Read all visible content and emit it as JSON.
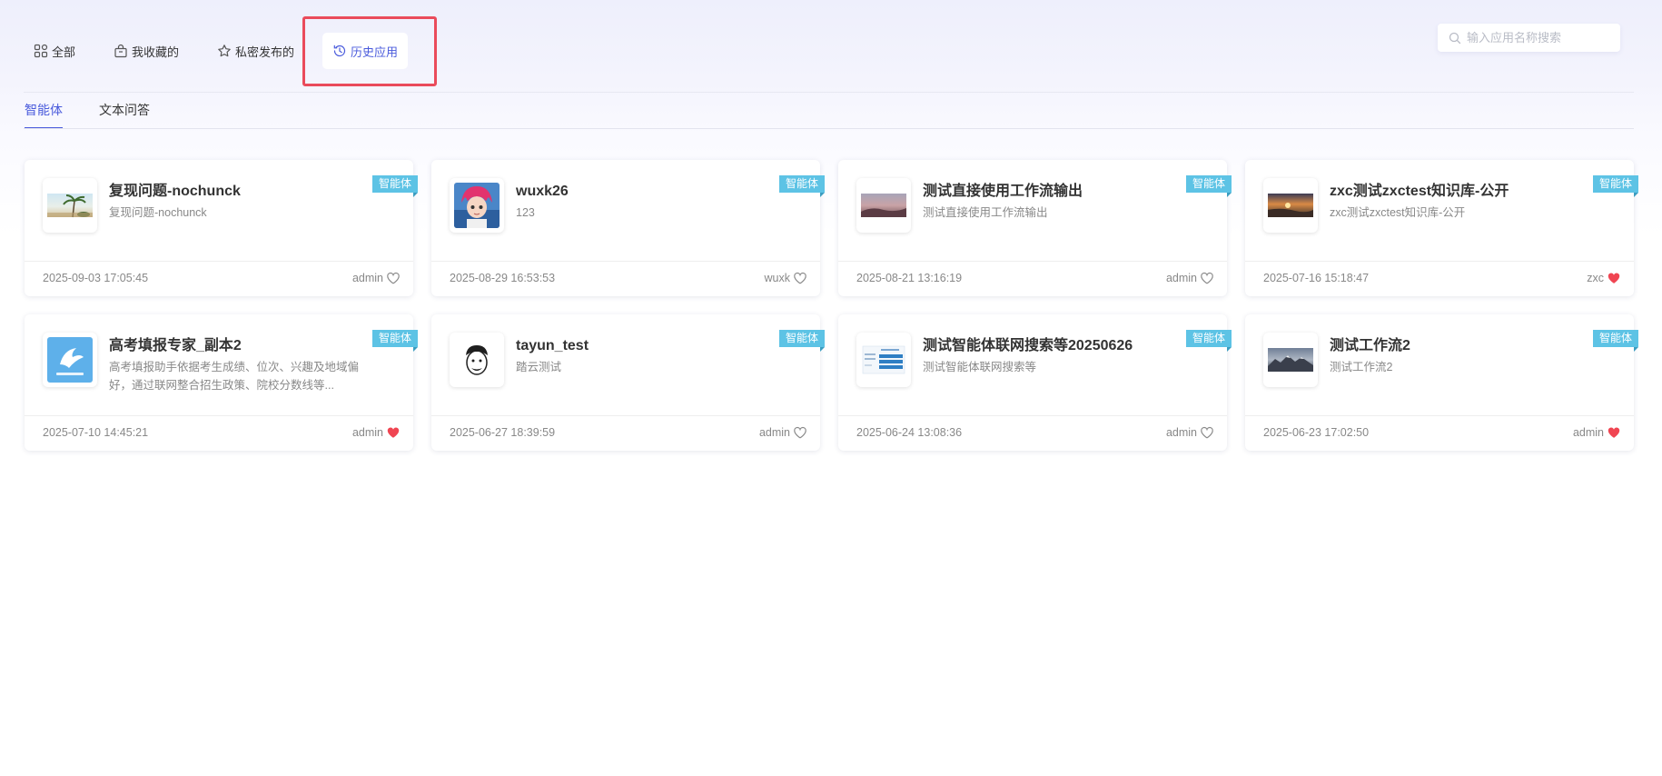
{
  "filters": [
    {
      "label": "全部",
      "icon": "grid-icon"
    },
    {
      "label": "我收藏的",
      "icon": "bag-icon"
    },
    {
      "label": "私密发布的",
      "icon": "star-icon"
    },
    {
      "label": "历史应用",
      "icon": "history-icon",
      "active": true
    }
  ],
  "search": {
    "placeholder": "输入应用名称搜索",
    "value": ""
  },
  "tabs": [
    {
      "label": "智能体",
      "active": true
    },
    {
      "label": "文本问答",
      "active": false
    }
  ],
  "colors": {
    "accent": "#4a5bdc",
    "badge": "#5dc3e5",
    "favorite": "#f04552",
    "highlight": "#ea4b5b"
  },
  "cards": [
    {
      "title": "复现问题-nochunck",
      "desc": "复现问题-nochunck",
      "badge": "智能体",
      "time": "2025-09-03 17:05:45",
      "owner": "admin",
      "favorited": false,
      "thumb": "beach-photo"
    },
    {
      "title": "wuxk26",
      "desc": "123",
      "badge": "智能体",
      "time": "2025-08-29 16:53:53",
      "owner": "wuxk",
      "favorited": false,
      "thumb": "anime-avatar"
    },
    {
      "title": "测试直接使用工作流输出",
      "desc": "测试直接使用工作流输出",
      "badge": "智能体",
      "time": "2025-08-21 13:16:19",
      "owner": "admin",
      "favorited": false,
      "thumb": "dusk-landscape"
    },
    {
      "title": "zxc测试zxctest知识库-公开",
      "desc": "zxc测试zxctest知识库-公开",
      "badge": "智能体",
      "time": "2025-07-16 15:18:47",
      "owner": "zxc",
      "favorited": true,
      "thumb": "sunset-photo"
    },
    {
      "title": "高考填报专家_副本2",
      "desc": "高考填报助手依据考生成绩、位次、兴趣及地域偏好，通过联网整合招生政策、院校分数线等...",
      "badge": "智能体",
      "time": "2025-07-10 14:45:21",
      "owner": "admin",
      "favorited": true,
      "thumb": "bird-logo"
    },
    {
      "title": "tayun_test",
      "desc": "踏云测试",
      "badge": "智能体",
      "time": "2025-06-27 18:39:59",
      "owner": "admin",
      "favorited": false,
      "thumb": "cartoon-face"
    },
    {
      "title": "测试智能体联网搜索等20250626",
      "desc": "测试智能体联网搜索等",
      "badge": "智能体",
      "time": "2025-06-24 13:08:36",
      "owner": "admin",
      "favorited": false,
      "thumb": "web-screenshot"
    },
    {
      "title": "测试工作流2",
      "desc": "测试工作流2",
      "badge": "智能体",
      "time": "2025-06-23 17:02:50",
      "owner": "admin",
      "favorited": true,
      "thumb": "mountain-photo"
    }
  ]
}
